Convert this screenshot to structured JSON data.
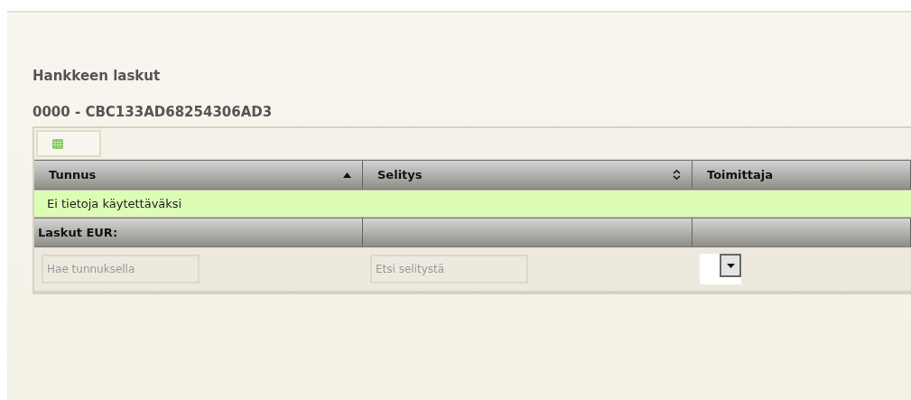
{
  "title": "Hankkeen laskut",
  "subtitle": "0000 - CBC133AD68254306AD3",
  "grid": {
    "columns": [
      {
        "label": "Tunnus",
        "sortable": true,
        "sorted": true
      },
      {
        "label": "Selitys",
        "sortable": true,
        "sorted": false
      },
      {
        "label": "Toimittaja",
        "sortable": false,
        "sorted": false
      }
    ],
    "empty_message": "Ei tietoja käytettäväksi",
    "footer": [
      "Laskut EUR:"
    ],
    "filters": [
      {
        "kind": "text",
        "placeholder": "Hae tunnuksella"
      },
      {
        "kind": "text",
        "placeholder": "Etsi selitystä"
      },
      {
        "kind": "select"
      }
    ]
  }
}
